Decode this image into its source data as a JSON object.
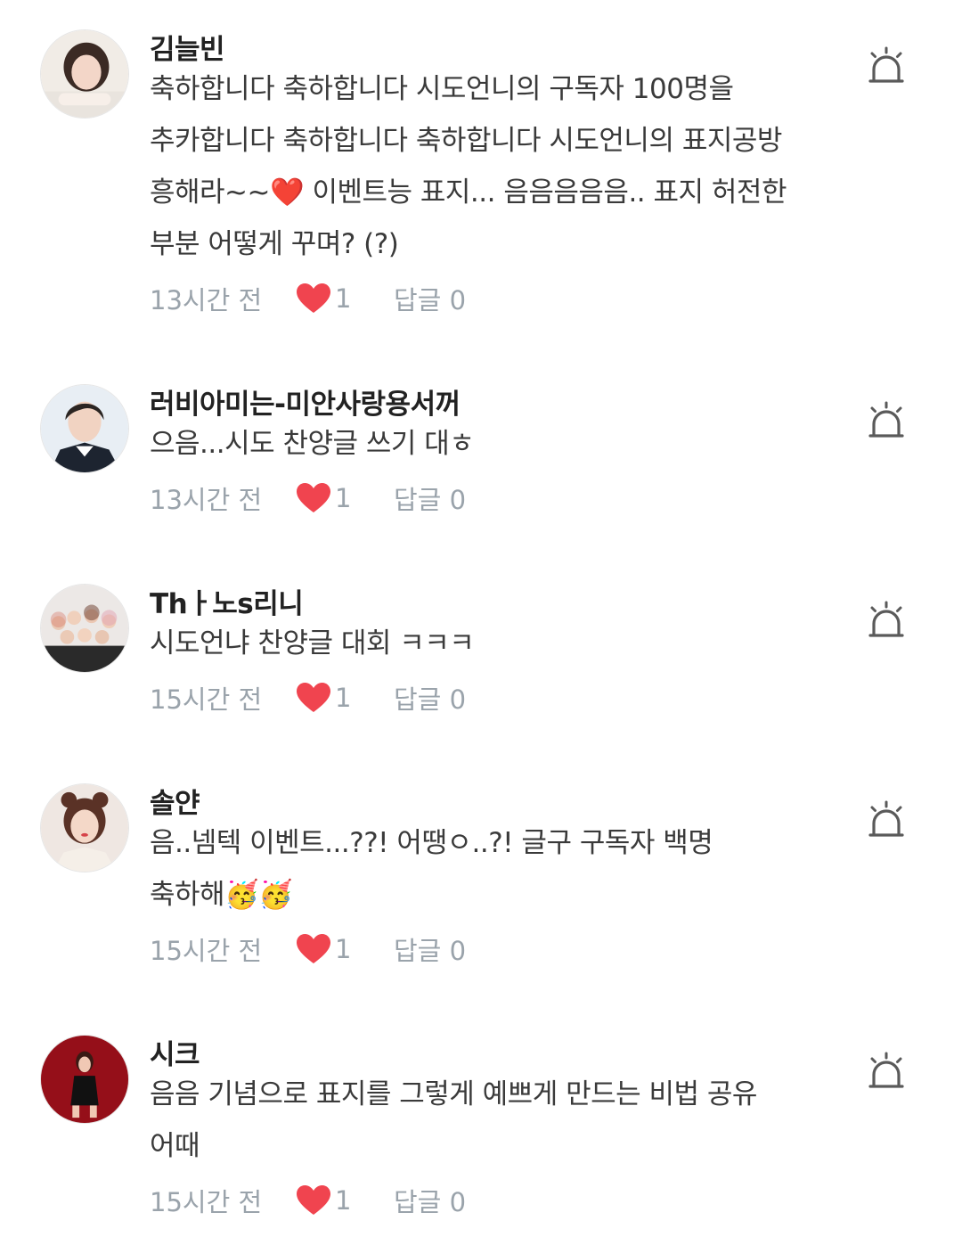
{
  "colors": {
    "heart": "#f0444f",
    "meta_text": "#9aa3ab",
    "username": "#222222",
    "body_text": "#3a3a3a",
    "icon": "#5a5a5a"
  },
  "icons": {
    "like": "heart-icon",
    "report": "siren-icon"
  },
  "comments": [
    {
      "username": "김늘빈",
      "lines": [
        "축하합니다 축하합니다 시도언니의 구독자 100명을",
        "추카합니다 축하합니다 축하합니다 시도언니의 표지공방",
        "흥해라~~❤️ 이벤트능 표지... 음음음음음.. 표지 허전한",
        "부분 어떻게 꾸며? (?)"
      ],
      "time": "13시간 전",
      "likes": "1",
      "reply_label": "답글",
      "reply_count": "0"
    },
    {
      "username": "러비아미는-미안사랑용서꺼",
      "lines": [
        "으음...시도 찬양글 쓰기 대ㅎ"
      ],
      "time": "13시간 전",
      "likes": "1",
      "reply_label": "답글",
      "reply_count": "0"
    },
    {
      "username": "Thㅏ노s리니",
      "lines": [
        "시도언냐 찬양글 대회 ㅋㅋㅋ"
      ],
      "time": "15시간 전",
      "likes": "1",
      "reply_label": "답글",
      "reply_count": "0"
    },
    {
      "username": "솔얀",
      "lines": [
        "음..넴텍 이벤트...??! 어땡ㅇ..?! 글구 구독자 백명",
        "축하해🥳🥳"
      ],
      "time": "15시간 전",
      "likes": "1",
      "reply_label": "답글",
      "reply_count": "0"
    },
    {
      "username": "시크",
      "lines": [
        "음음 기념으로 표지를 그렇게 예쁘게 만드는 비법 공유",
        "어때"
      ],
      "time": "15시간 전",
      "likes": "1",
      "reply_label": "답글",
      "reply_count": "0"
    }
  ]
}
